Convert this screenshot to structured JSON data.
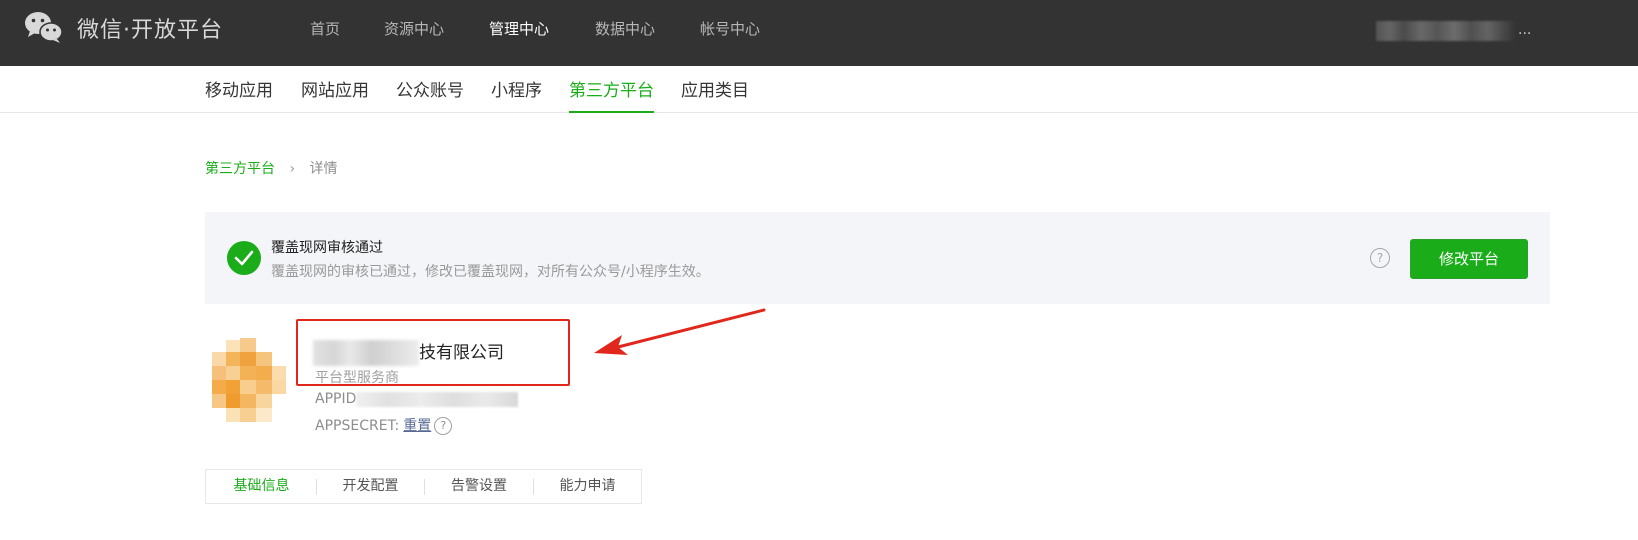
{
  "header": {
    "brand": "微信·开放平台",
    "nav": [
      "首页",
      "资源中心",
      "管理中心",
      "数据中心",
      "帐号中心"
    ],
    "active_nav": "管理中心",
    "account_suffix": "..."
  },
  "subnav": {
    "items": [
      "移动应用",
      "网站应用",
      "公众账号",
      "小程序",
      "第三方平台",
      "应用类目"
    ],
    "active": "第三方平台"
  },
  "breadcrumb": {
    "parent": "第三方平台",
    "separator": "›",
    "current": "详情"
  },
  "notice": {
    "title": "覆盖现网审核通过",
    "description": "覆盖现网的审核已通过，修改已覆盖现网，对所有公众号/小程序生效。",
    "help_symbol": "?",
    "modify_button": "修改平台"
  },
  "platform": {
    "name_visible": "技有限公司",
    "type": "平台型服务商",
    "appid_label": "APPID",
    "appsecret_label": "APPSECRET:",
    "reset_link": "重置",
    "help_symbol": "?"
  },
  "tabs": {
    "items": [
      "基础信息",
      "开发配置",
      "告警设置",
      "能力申请"
    ],
    "active": "基础信息"
  },
  "colors": {
    "brand_green": "#1aad19",
    "topbar": "#333333",
    "annotation_red": "#e1261c",
    "link_blue": "#576b95"
  }
}
